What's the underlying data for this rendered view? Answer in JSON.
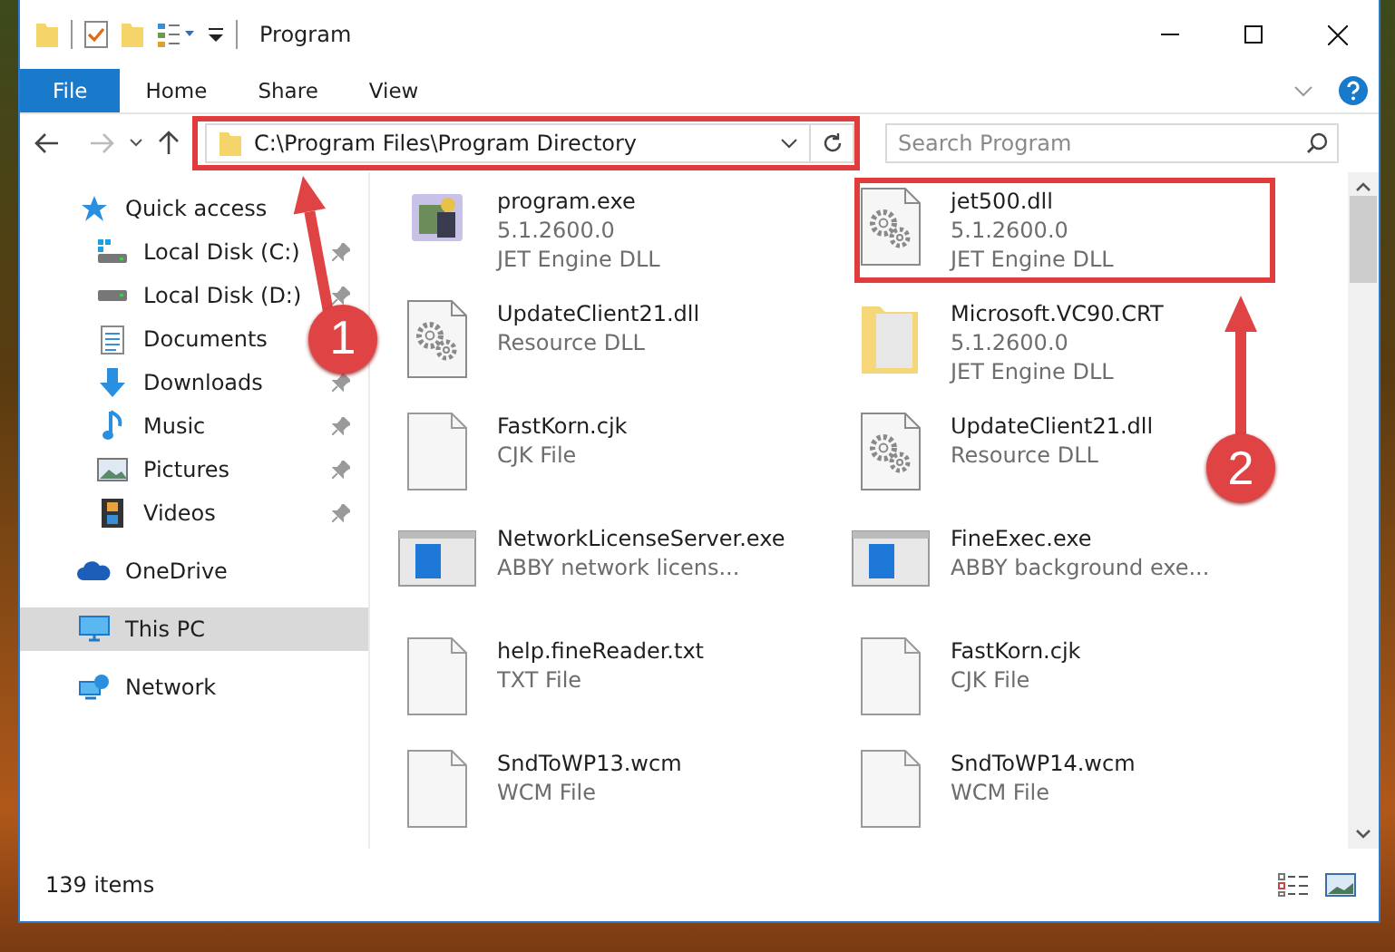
{
  "window": {
    "title": "Program"
  },
  "ribbon_tabs": [
    {
      "label": "File",
      "kind": "file"
    },
    {
      "label": "Home",
      "kind": "tab"
    },
    {
      "label": "Share",
      "kind": "tab"
    },
    {
      "label": "View",
      "kind": "tab"
    }
  ],
  "address_bar": {
    "path": "C:\\Program Files\\Program Directory",
    "highlighted": true
  },
  "search": {
    "placeholder": "Search Program"
  },
  "nav": [
    {
      "label": "Quick access",
      "kind": "star",
      "selected": false,
      "children": [
        {
          "label": "Local Disk (C:)",
          "kind": "system-drive",
          "pinned": true,
          "selected": false
        },
        {
          "label": "Local Disk (D:)",
          "kind": "drive",
          "pinned": true,
          "selected": false
        },
        {
          "label": "Documents",
          "kind": "documents",
          "selected": false
        },
        {
          "label": "Downloads",
          "kind": "downloads",
          "pinned": true,
          "selected": false
        },
        {
          "label": "Music",
          "kind": "music",
          "pinned": true,
          "selected": false
        },
        {
          "label": "Pictures",
          "kind": "pictures",
          "pinned": true,
          "selected": false
        },
        {
          "label": "Videos",
          "kind": "videos",
          "pinned": true,
          "selected": false
        }
      ]
    },
    {
      "label": "OneDrive",
      "kind": "cloud",
      "selected": false
    },
    {
      "label": "This PC",
      "kind": "computer",
      "selected": true
    },
    {
      "label": "Network",
      "kind": "network",
      "selected": false
    }
  ],
  "files": [
    {
      "name": "program.exe",
      "details": [
        "5.1.2600.0",
        "JET Engine DLL"
      ],
      "kind": "app",
      "highlighted": false
    },
    {
      "name": "jet500.dll",
      "details": [
        "5.1.2600.0",
        "JET Engine DLL"
      ],
      "kind": "dll",
      "highlighted": true
    },
    {
      "name": "UpdateClient21.dll",
      "details": [
        "Resource DLL"
      ],
      "kind": "dll",
      "highlighted": false
    },
    {
      "name": "Microsoft.VC90.CRT",
      "details": [
        "5.1.2600.0",
        "JET Engine DLL"
      ],
      "kind": "folder",
      "highlighted": false
    },
    {
      "name": "FastKorn.cjk",
      "details": [
        "CJK File"
      ],
      "kind": "file",
      "highlighted": false
    },
    {
      "name": "UpdateClient21.dll",
      "details": [
        "Resource DLL"
      ],
      "kind": "dll",
      "highlighted": false
    },
    {
      "name": "NetworkLicenseServer.exe",
      "details": [
        "ABBY network licens..."
      ],
      "kind": "window",
      "highlighted": false
    },
    {
      "name": "FineExec.exe",
      "details": [
        "ABBY background exe..."
      ],
      "kind": "window",
      "highlighted": false
    },
    {
      "name": "help.fineReader.txt",
      "details": [
        "TXT File"
      ],
      "kind": "file",
      "highlighted": false
    },
    {
      "name": "FastKorn.cjk",
      "details": [
        "CJK File"
      ],
      "kind": "file",
      "highlighted": false
    },
    {
      "name": "SndToWP13.wcm",
      "details": [
        "WCM File"
      ],
      "kind": "file",
      "highlighted": false
    },
    {
      "name": "SndToWP14.wcm",
      "details": [
        "WCM File"
      ],
      "kind": "file",
      "highlighted": false
    }
  ],
  "annotations": [
    {
      "label": "1"
    },
    {
      "label": "2"
    }
  ],
  "status_bar": {
    "count": "139 items"
  }
}
